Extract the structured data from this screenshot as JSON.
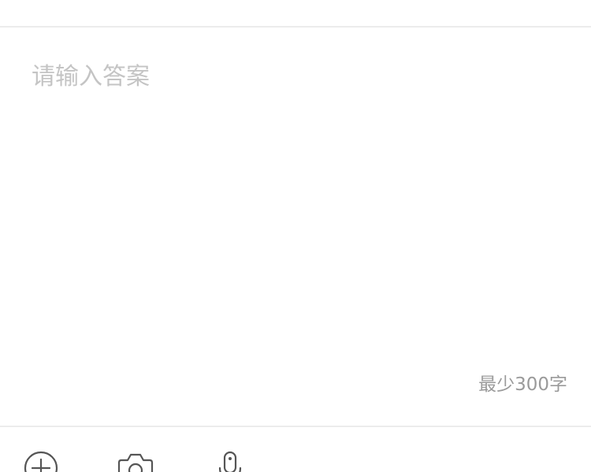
{
  "answer_editor": {
    "placeholder": "请输入答案",
    "value": "",
    "min_length_hint": "最少300字"
  },
  "toolbar": {
    "items": [
      {
        "name": "add",
        "icon": "plus-circle-icon"
      },
      {
        "name": "camera",
        "icon": "camera-icon"
      },
      {
        "name": "voice",
        "icon": "microphone-icon"
      }
    ]
  },
  "colors": {
    "background": "#ffffff",
    "divider": "#ececec",
    "placeholder": "#c4c4c4",
    "hint_text": "#9a9a9a",
    "icon": "#555555"
  }
}
